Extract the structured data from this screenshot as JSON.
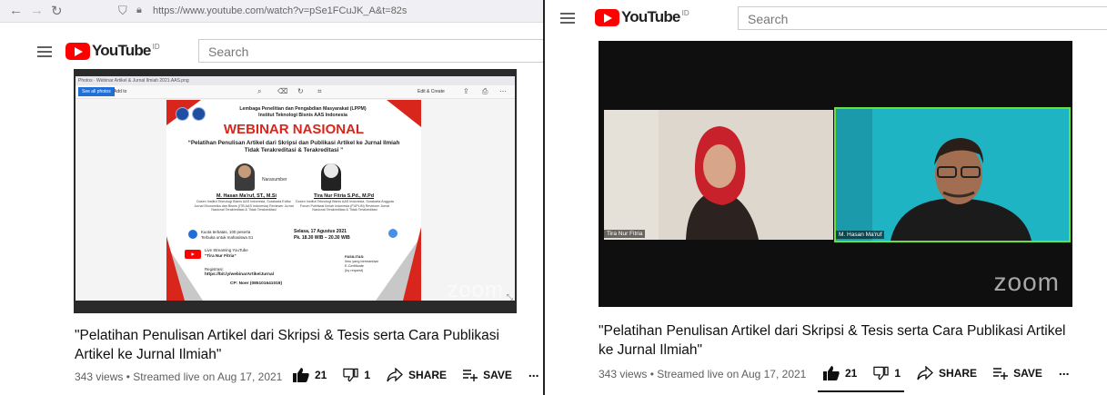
{
  "left": {
    "browser": {
      "url": "https://www.youtube.com/watch?v=pSe1FCuJK_A&t=82s"
    },
    "search_placeholder": "Search",
    "poster": {
      "breadcrumb": "Photos · Webinar Artikel & Jurnal Ilmiah 2021.AAS.png",
      "see_all": "See all photos",
      "add_to": "Add to",
      "edit_create": "Edit & Create",
      "org_line1": "Lembaga Penelitian dan Pengabdian Masyarakat (LPPM)",
      "org_line2": "Institut Teknologi Bisnis AAS Indonesia",
      "heading": "WEBINAR NASIONAL",
      "subtitle": "“Pelatihan Penulisan Artikel dari Skripsi dan Publikasi Artikel ke Jurnal Ilmiah Tidak Terakreditasi & Terakreditasi ”",
      "narasumber": "Narasumber",
      "speaker1_name": "M. Hasan Ma'ruf, ST., M.Si",
      "speaker1_desc": "Dosen Institut Teknologi Bisnis AAS Indonesia, Surakarta Editor Jurnal Ekonomika dan Bisnis (ITB AAS Indonesia) Reviewer Jurnal Nasional Terakreditasi & Tidak Terakreditasi",
      "speaker2_name": "Tira Nur Fitria S.Pd., M.Pd",
      "speaker2_desc": "Dosen Institut Teknologi Bisnis AAS Indonesia, Surakarta Anggota Forum Publikasi Ilmiah Indonesia (FUPLIN) Reviewer Jurnal Nasional Terakreditasi & Tidak Terakreditasi",
      "quota1": "Kuota terbatas, 100 peserta",
      "quota2": "Terbuka untuk mahasiswa S1",
      "date": "Selasa, 17 Agustus 2021",
      "time": "Pk. 18.30 WIB – 20.30 WIB",
      "live1": "Live Streaming YouTube",
      "live2": "“Tira Nur Fitria”",
      "reg_label": "Registrasi:",
      "reg_link": "https://bit.ly/webinarArtikelJurnal",
      "cp": "CP: Noer (085101641019)",
      "fasilitas": "FASILITAS:",
      "f1": "Ilmu yang bermanfaat",
      "f2": "E-Certificate",
      "f3": "(by request)"
    },
    "zoom_label": "zoom",
    "title": "\"Pelatihan Penulisan Artikel dari Skripsi & Tesis serta Cara Publikasi Artikel ke Jurnal Ilmiah\"",
    "meta": "343 views • Streamed live on Aug 17, 2021",
    "likes": "21",
    "dislikes": "1",
    "share": "SHARE",
    "save": "SAVE",
    "more": "..."
  },
  "right": {
    "search_placeholder": "Search",
    "participant1": "Tira Nur Fitria",
    "participant2": "M. Hasan Ma'ruf",
    "zoom_label": "zoom",
    "title": "\"Pelatihan Penulisan Artikel dari Skripsi & Tesis serta Cara Publikasi Artikel ke Jurnal Ilmiah\"",
    "meta": "343 views • Streamed live on Aug 17, 2021",
    "likes": "21",
    "dislikes": "1",
    "share": "SHARE",
    "save": "SAVE",
    "more": "..."
  },
  "brand": {
    "logo_text": "YouTube",
    "logo_sup": "ID",
    "red": "#ff0000"
  },
  "colors": {
    "zoom_active_border": "#6ce03a",
    "poster_red": "#d9261c"
  }
}
